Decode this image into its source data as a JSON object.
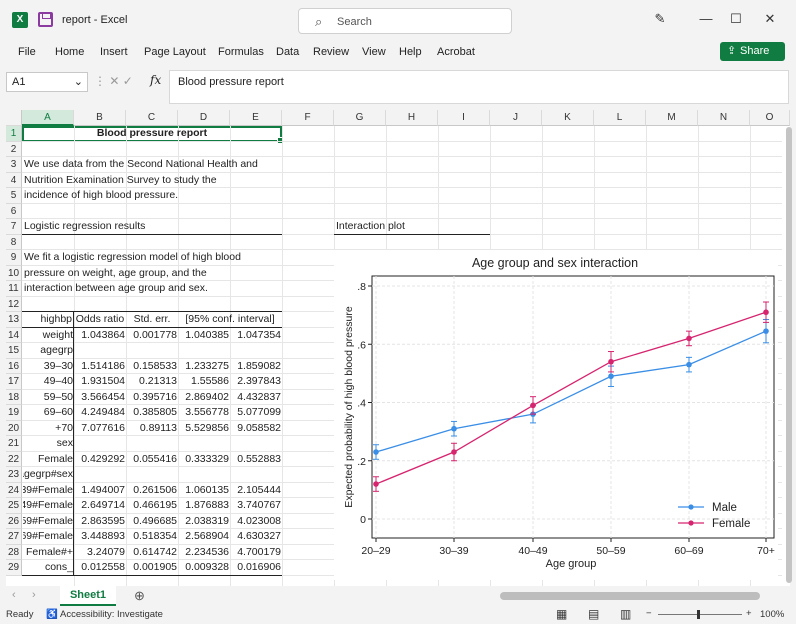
{
  "titlebar": {
    "filename": "report",
    "app": "Excel",
    "search_placeholder": "Search"
  },
  "menu": [
    "File",
    "Home",
    "Insert",
    "Page Layout",
    "Formulas",
    "Data",
    "Review",
    "View",
    "Help",
    "Acrobat"
  ],
  "share_label": "Share",
  "formula_bar": {
    "name_box": "A1",
    "fx": "fx",
    "content": "Blood pressure report"
  },
  "columns": [
    "A",
    "B",
    "C",
    "D",
    "E",
    "F",
    "G",
    "H",
    "I",
    "J",
    "K",
    "L",
    "M",
    "N",
    "O"
  ],
  "rows": [
    "1",
    "2",
    "3",
    "4",
    "5",
    "6",
    "7",
    "8",
    "9",
    "10",
    "11",
    "12",
    "13",
    "14",
    "15",
    "16",
    "17",
    "18",
    "19",
    "20",
    "21",
    "22",
    "23",
    "24",
    "25",
    "26",
    "27",
    "28",
    "29"
  ],
  "text_cells": {
    "r1": "Blood pressure report",
    "r3": "We use data from the Second National Health and",
    "r4": "Nutrition Examination Survey to study the",
    "r5": "incidence of high blood pressure.",
    "r7": "Logistic regression results",
    "r7g": "Interaction plot",
    "r9": "We fit a logistic regression model of high blood",
    "r10": "pressure on weight, age group, and the",
    "r11": "interaction between age group and sex."
  },
  "table": {
    "header": [
      "highbp",
      "Odds ratio",
      "Std. err.",
      "[95% conf. interval]",
      ""
    ],
    "rows": [
      [
        "weight",
        "1.043864",
        "0.001778",
        "1.040385",
        "1.047354"
      ],
      [
        "agegrp",
        "",
        "",
        "",
        ""
      ],
      [
        "30–39",
        "1.514186",
        "0.158533",
        "1.233275",
        "1.859082"
      ],
      [
        "40–49",
        "1.931504",
        "0.21313",
        "1.55586",
        "2.397843"
      ],
      [
        "50–59",
        "3.566454",
        "0.395716",
        "2.869402",
        "4.432837"
      ],
      [
        "60–69",
        "4.249484",
        "0.385805",
        "3.556778",
        "5.077099"
      ],
      [
        "70+",
        "7.077616",
        "0.89113",
        "5.529856",
        "9.058582"
      ],
      [
        "sex",
        "",
        "",
        "",
        ""
      ],
      [
        "Female",
        "0.429292",
        "0.055416",
        "0.333329",
        "0.552883"
      ],
      [
        "agegrp#sex",
        "",
        "",
        "",
        ""
      ],
      [
        "39#Female",
        "1.494007",
        "0.261506",
        "1.060135",
        "2.105444"
      ],
      [
        "49#Female",
        "2.649714",
        "0.466195",
        "1.876883",
        "3.740767"
      ],
      [
        "59#Female",
        "2.863595",
        "0.496685",
        "2.038319",
        "4.023008"
      ],
      [
        "69#Female",
        "3.448893",
        "0.518354",
        "2.568904",
        "4.630327"
      ],
      [
        "+#Female",
        "3.24079",
        "0.614742",
        "2.234536",
        "4.700179"
      ],
      [
        "_cons",
        "0.012558",
        "0.001905",
        "0.009328",
        "0.016906"
      ]
    ]
  },
  "sheet_tab": "Sheet1",
  "status": {
    "ready": "Ready",
    "accessibility": "Accessibility: Investigate",
    "zoom": "100%"
  },
  "chart_data": {
    "type": "line",
    "title": "Age group and sex interaction",
    "xlabel": "Age group",
    "ylabel": "Expected probability of high blood pressure",
    "categories": [
      "20–29",
      "30–39",
      "40–49",
      "50–59",
      "60–69",
      "70+"
    ],
    "yticks": [
      ".8",
      ".6",
      ".4",
      ".2",
      "0"
    ],
    "ylim": [
      0,
      0.8
    ],
    "series": [
      {
        "name": "Male",
        "color": "#3a8ee6",
        "values": [
          0.23,
          0.31,
          0.36,
          0.49,
          0.53,
          0.645
        ],
        "lo": [
          0.205,
          0.285,
          0.33,
          0.455,
          0.505,
          0.605
        ],
        "hi": [
          0.255,
          0.335,
          0.39,
          0.525,
          0.555,
          0.685
        ]
      },
      {
        "name": "Female",
        "color": "#d6246e",
        "values": [
          0.12,
          0.23,
          0.39,
          0.54,
          0.62,
          0.71
        ],
        "lo": [
          0.095,
          0.2,
          0.36,
          0.505,
          0.595,
          0.675
        ],
        "hi": [
          0.145,
          0.26,
          0.42,
          0.575,
          0.645,
          0.745
        ]
      }
    ],
    "legend": "bottom-right",
    "grid": true
  }
}
